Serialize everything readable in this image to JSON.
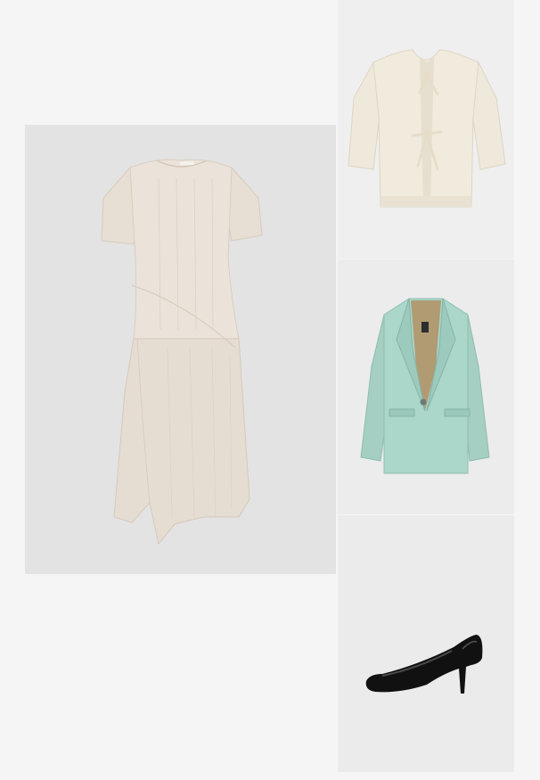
{
  "collage": {
    "items": [
      {
        "name": "dress",
        "color": "#e6ddd3"
      },
      {
        "name": "cardigan",
        "color": "#efe9da"
      },
      {
        "name": "blazer",
        "color": "#a8d2c6"
      },
      {
        "name": "heels",
        "color": "#111111"
      }
    ],
    "background": "#f5f5f5"
  }
}
